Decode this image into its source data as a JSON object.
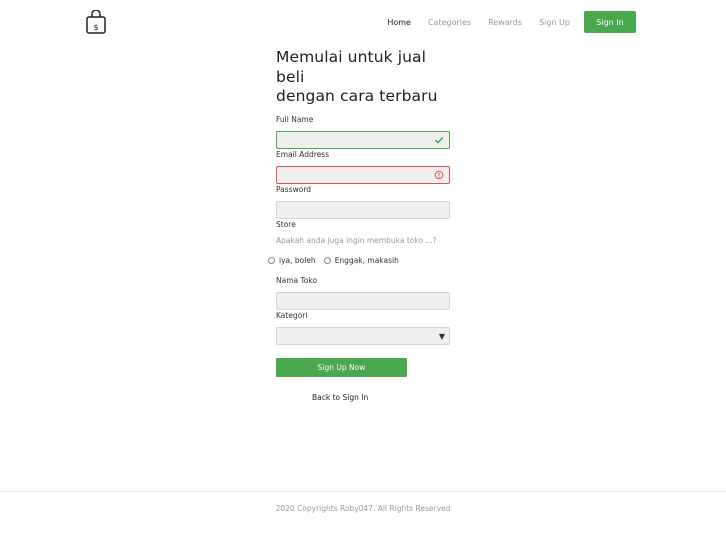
{
  "header": {
    "logo_glyph": "$",
    "nav": [
      {
        "label": "Home",
        "active": true
      },
      {
        "label": "Categories",
        "active": false
      },
      {
        "label": "Rewards",
        "active": false
      },
      {
        "label": "Sign Up",
        "active": false
      }
    ],
    "signin_label": "Sign In"
  },
  "form": {
    "headline_line1": "Memulai untuk jual",
    "headline_line2": "beli",
    "headline_line3": "dengan cara terbaru",
    "full_name": {
      "label": "Full Name",
      "value": "",
      "status": "valid"
    },
    "email": {
      "label": "Email Address",
      "value": "",
      "status": "error"
    },
    "password": {
      "label": "Password",
      "value": ""
    },
    "store": {
      "label": "Store",
      "question": "Apakah anda juga ingin membuka toko ...?",
      "options": [
        "iya, boleh",
        "Enggak, makasih"
      ]
    },
    "store_name": {
      "label": "Nama Toko",
      "value": ""
    },
    "category": {
      "label": "Kategori",
      "selected": ""
    },
    "submit_label": "Sign Up Now",
    "back_label": "Back to Sign In"
  },
  "footer": {
    "text": "2020 Copyrights Roby047. All Rights Reserved"
  },
  "colors": {
    "accent": "#4aa84f",
    "error": "#d9534f"
  }
}
